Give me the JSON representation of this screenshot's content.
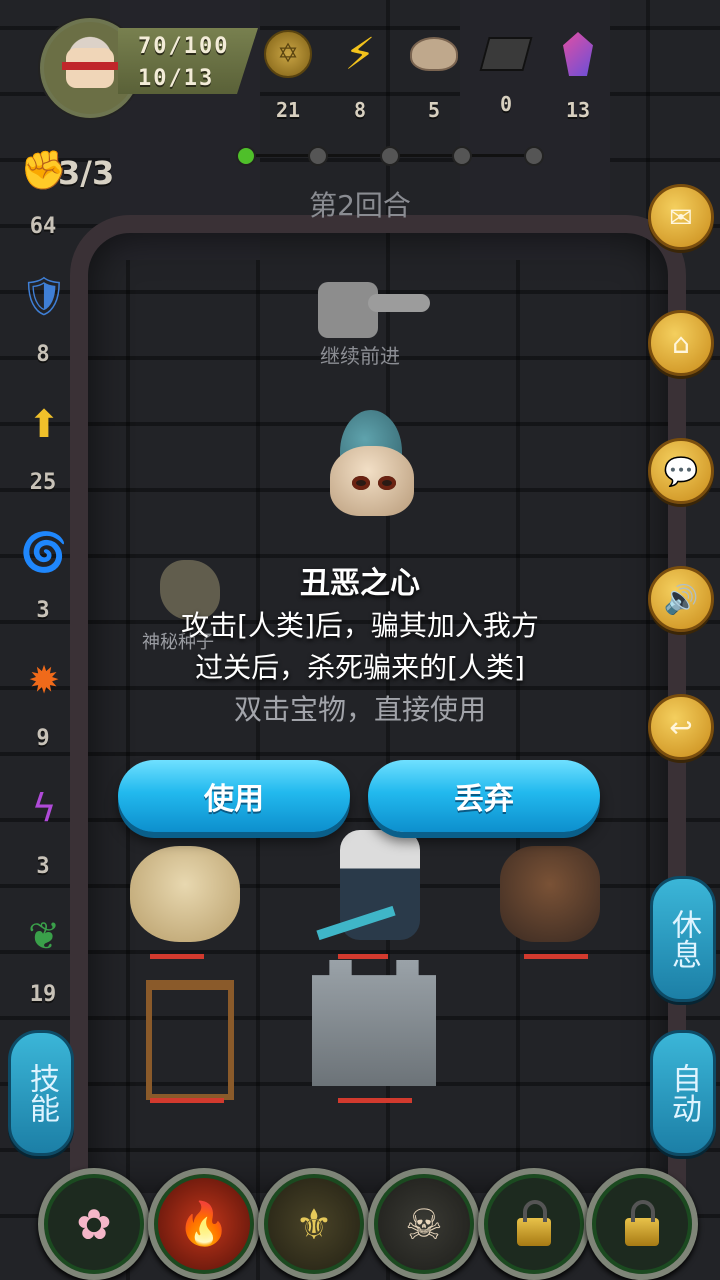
{
  "hud": {
    "hp": "70/100",
    "level": "10/13",
    "resources": [
      {
        "icon": "coin-icon",
        "count": "21"
      },
      {
        "icon": "lightning-icon",
        "count": "8"
      },
      {
        "icon": "bread-icon",
        "count": "5"
      },
      {
        "icon": "ore-icon",
        "count": "0"
      },
      {
        "icon": "crystal-icon",
        "count": "13"
      }
    ],
    "round_label": "第2回合",
    "progress": {
      "current_node": 1,
      "total_nodes": 5
    }
  },
  "left_panel": {
    "attack_uses": "3/3",
    "stats": [
      "64",
      "8",
      "25",
      "3",
      "9",
      "3",
      "19"
    ],
    "skill_button": "技能"
  },
  "right_panel": {
    "rest_button": "休息",
    "auto_button": "自动"
  },
  "map": {
    "continue_label": "继续前进",
    "seed_label": "神秘种子"
  },
  "popup": {
    "item_name": "丑恶之心",
    "desc_line1": "攻击[人类]后，骗其加入我方",
    "desc_line2": "过关后，杀死骗来的[人类]",
    "hint": "双击宝物，直接使用",
    "use_label": "使用",
    "discard_label": "丢弃"
  },
  "colors": {
    "button_blue": "#22b9ee",
    "gold": "#f2c21c",
    "hp_red": "#d23a2e"
  }
}
